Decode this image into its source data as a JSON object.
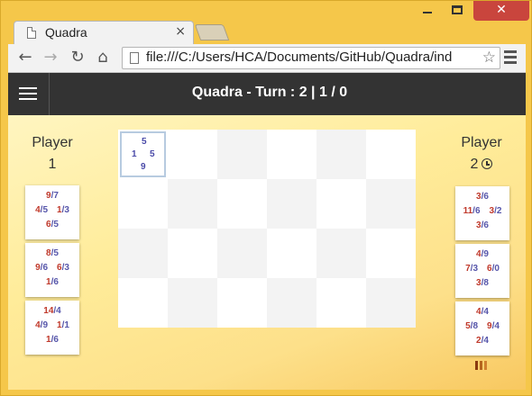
{
  "browser": {
    "tab_title": "Quadra",
    "tab_close": "×",
    "url": "file:///C:/Users/HCA/Documents/GitHub/Quadra/ind",
    "window_controls": {
      "minimize": "minimize-icon",
      "maximize": "maximize-icon",
      "close": "✕"
    }
  },
  "toolbar": {
    "back": "←",
    "forward": "→",
    "reload": "↻",
    "home": "⌂",
    "star": "☆"
  },
  "app": {
    "title": "Quadra - Turn : 2 | 1 / 0",
    "player1": {
      "label": "Player",
      "number": "1"
    },
    "player2": {
      "label": "Player",
      "number": "2"
    },
    "player1_cards": [
      {
        "top": [
          "9",
          "/",
          "7"
        ],
        "left": [
          "4",
          "/",
          "5"
        ],
        "right": [
          "1",
          "/",
          "3"
        ],
        "bottom": [
          "6",
          "/",
          "5"
        ]
      },
      {
        "top": [
          "8",
          "/",
          "5"
        ],
        "left": [
          "9",
          "/",
          "6"
        ],
        "right": [
          "6",
          "/",
          "3"
        ],
        "bottom": [
          "1",
          "/",
          "6"
        ]
      },
      {
        "top": [
          "14",
          "/",
          "4"
        ],
        "left": [
          "4",
          "/",
          "9"
        ],
        "right": [
          "1",
          "/",
          "1"
        ],
        "bottom": [
          "1",
          "/",
          "6"
        ]
      }
    ],
    "player2_cards": [
      {
        "top": [
          "3",
          "/",
          "6"
        ],
        "left": [
          "11",
          "/",
          "6"
        ],
        "right": [
          "3",
          "/",
          "2"
        ],
        "bottom": [
          "3",
          "/",
          "6"
        ]
      },
      {
        "top": [
          "4",
          "/",
          "9"
        ],
        "left": [
          "7",
          "/",
          "3"
        ],
        "right": [
          "6",
          "/",
          "0"
        ],
        "bottom": [
          "3",
          "/",
          "8"
        ]
      },
      {
        "top": [
          "4",
          "/",
          "4"
        ],
        "left": [
          "5",
          "/",
          "8"
        ],
        "right": [
          "9",
          "/",
          "4"
        ],
        "bottom": [
          "2",
          "/",
          "4"
        ]
      }
    ],
    "board_piece": {
      "top": "5",
      "left": "1",
      "right": "5",
      "bottom": "9"
    },
    "colors": {
      "red": "#c0392b",
      "blue": "#5555aa",
      "bar": "#333333"
    }
  }
}
